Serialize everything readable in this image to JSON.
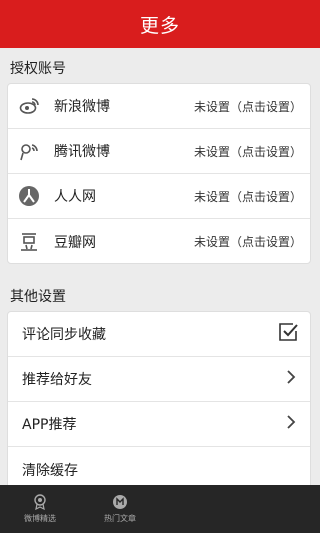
{
  "header": {
    "title": "更多"
  },
  "auth_section": {
    "label": "授权账号",
    "accounts": [
      {
        "name": "新浪微博",
        "status": "未设置（点击设置）",
        "icon": "weibo-icon"
      },
      {
        "name": "腾讯微博",
        "status": "未设置（点击设置）",
        "icon": "tencent-weibo-icon"
      },
      {
        "name": "人人网",
        "status": "未设置（点击设置）",
        "icon": "renren-icon"
      },
      {
        "name": "豆瓣网",
        "status": "未设置（点击设置）",
        "icon": "douban-icon"
      }
    ]
  },
  "other_section": {
    "label": "其他设置",
    "items": [
      {
        "label": "评论同步收藏",
        "control": "checkbox",
        "checked": true
      },
      {
        "label": "推荐给好友",
        "control": "chevron"
      },
      {
        "label": "APP推荐",
        "control": "chevron"
      },
      {
        "label": "清除缓存",
        "control": "none"
      }
    ]
  },
  "tabbar": {
    "tabs": [
      {
        "label": "微博精选",
        "icon": "badge-icon"
      },
      {
        "label": "热门文章",
        "icon": "hot-article-icon"
      }
    ]
  },
  "colors": {
    "accent": "#d91d1d",
    "tabbar": "#262626"
  }
}
